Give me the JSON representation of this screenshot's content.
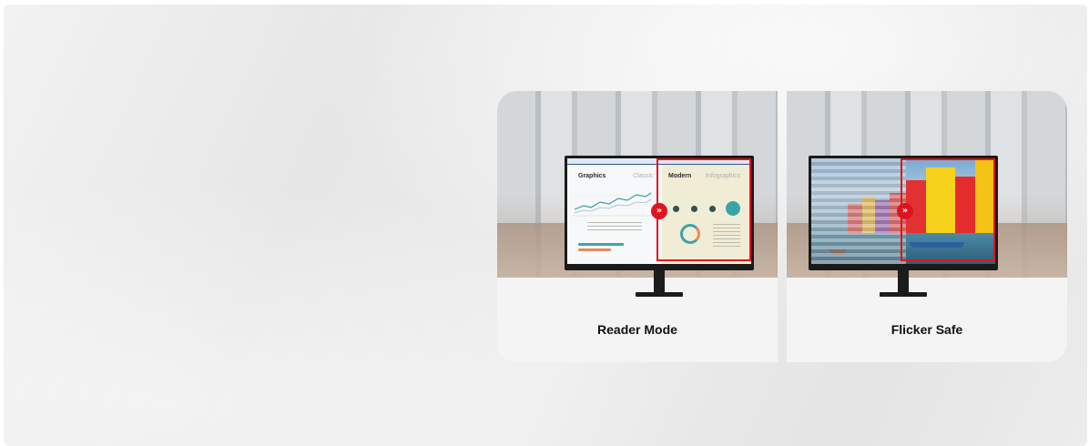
{
  "features": [
    {
      "label": "Reader Mode",
      "screen": {
        "title_left": "Graphics",
        "title_left_faded": "Classic",
        "title_right": "Modern",
        "title_right_faded": "Infographics"
      }
    },
    {
      "label": "Flicker Safe"
    }
  ],
  "icons": {
    "compare_arrow": "double-chevron-right-icon"
  },
  "colors": {
    "highlight": "#e0141e",
    "label_text": "#111111",
    "card_bg": "#f4f4f4",
    "accent_teal": "#39a4a8"
  }
}
